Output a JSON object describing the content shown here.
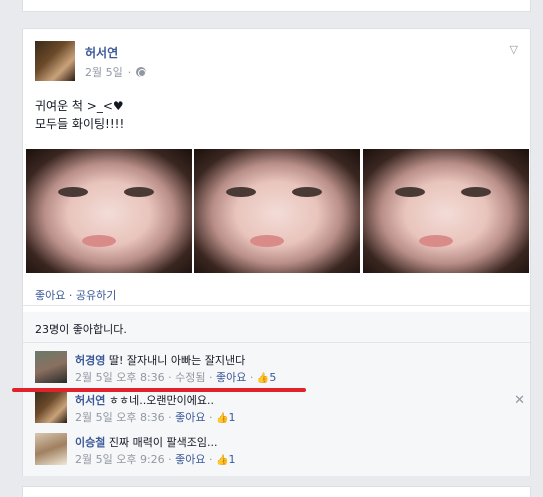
{
  "post": {
    "author": "허서연",
    "date": "2월 5일",
    "privacy_icon": "globe-icon",
    "menu_icon": "chevron-down-icon",
    "text_line1": "귀여운 척 >_<♥",
    "text_line2": "모두들 화이팅!!!!",
    "actions": "좋아요 · 공유하기",
    "likes_summary": "23명이 좋아합니다."
  },
  "comments": [
    {
      "author": "허경영",
      "text": "딸! 잘자내니 아빠는 잘지낸다",
      "time": "2월 5일 오후 8:36",
      "edited": "수정됨",
      "like_label": "좋아요",
      "like_count": "5"
    },
    {
      "author": "허서연",
      "text": "ㅎㅎ네..오랜만이에요..",
      "time": "2월 5일 오후 8:36",
      "like_label": "좋아요",
      "like_count": "1"
    },
    {
      "author": "이승철",
      "text": "진짜 매력이 팔색조임...",
      "time": "2월 5일 오후 9:26",
      "like_label": "좋아요",
      "like_count": "1"
    }
  ],
  "colors": {
    "link": "#3b5998",
    "meta": "#9197a3",
    "highlight_line": "#e2222a"
  }
}
